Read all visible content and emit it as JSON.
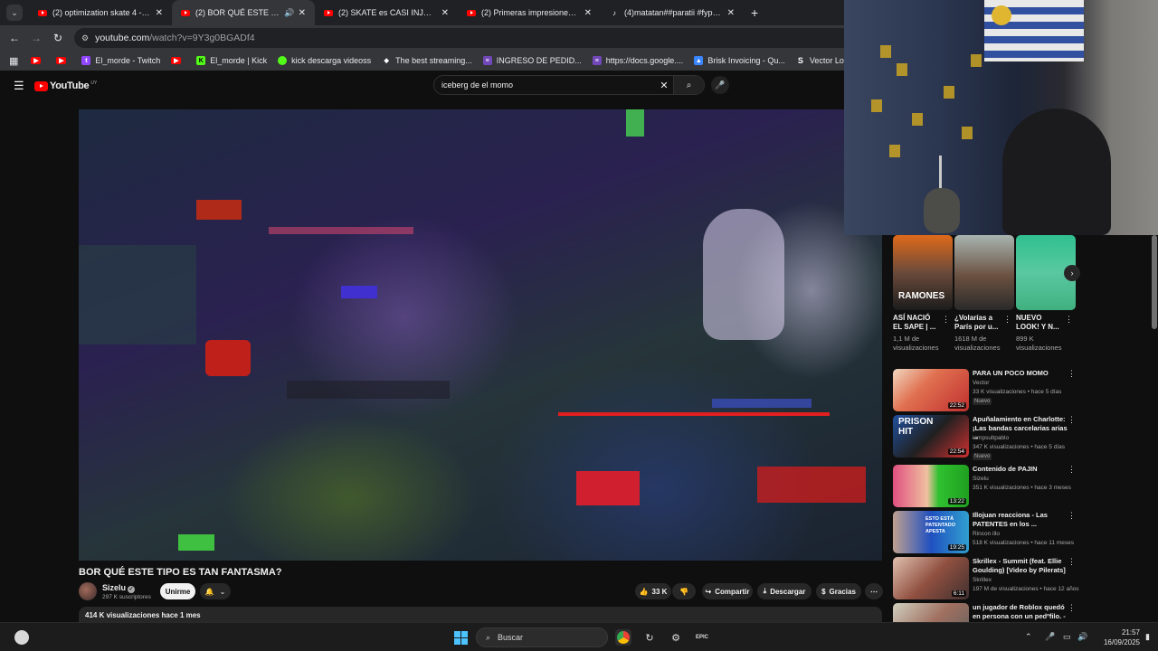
{
  "browser": {
    "tabs": [
      {
        "title": "(2) optimization skate 4 - YouTube",
        "icon": "youtube",
        "active": false
      },
      {
        "title": "(2) BOR QUÉ ESTE TIPO ES TAN FANTASMA?",
        "icon": "youtube",
        "active": true,
        "audio": true
      },
      {
        "title": "(2) SKATE es CASI INJUGABLE en...",
        "icon": "youtube",
        "active": false
      },
      {
        "title": "(2) Primeras impresiones de Mi...",
        "icon": "youtube",
        "active": false
      },
      {
        "title": "(4)matatan##paratii #fyp #ome...",
        "icon": "tiktok",
        "active": false
      }
    ],
    "url_host": "youtube.com",
    "url_path": "/watch?v=9Y3g0BGADf4",
    "bookmarks": [
      {
        "label": "",
        "icon": "youtube",
        "color": "#ff0000"
      },
      {
        "label": "",
        "icon": "youtube",
        "color": "#ff0000"
      },
      {
        "label": "El_morde - Twitch",
        "icon": "twitch",
        "color": "#9146ff"
      },
      {
        "label": "",
        "icon": "youtube",
        "color": "#ff0000"
      },
      {
        "label": "El_morde | Kick",
        "icon": "kick",
        "color": "#53fc18"
      },
      {
        "label": "kick descarga videoss",
        "icon": "kick-alt",
        "color": "#53fc18"
      },
      {
        "label": "The best streaming...",
        "icon": "diamond",
        "color": "#ffffff"
      },
      {
        "label": "INGRESO DE PEDID...",
        "icon": "forms",
        "color": "#7248b9"
      },
      {
        "label": "https://docs.google....",
        "icon": "forms",
        "color": "#7248b9"
      },
      {
        "label": "Brisk Invoicing - Qu...",
        "icon": "brisk",
        "color": "#3a86ff"
      },
      {
        "label": "Vector Logos, PNG L...",
        "icon": "vector",
        "color": "#ffffff"
      },
      {
        "label": "",
        "icon": "x",
        "color": "#000000"
      },
      {
        "label": "",
        "icon": "facebook",
        "color": "#1877f2"
      }
    ]
  },
  "youtube": {
    "logo_text": "YouTube",
    "logo_country": "UY",
    "search_value": "iceberg de el momo",
    "video": {
      "title": "BOR QUÉ ESTE TIPO ES TAN FANTASMA?",
      "channel": "Sizelu",
      "subscribers": "297 K suscriptores",
      "join_label": "Unirme",
      "likes": "33 K",
      "share_label": "Compartir",
      "download_label": "Descargar",
      "thanks_label": "Gracias",
      "views_date": "414 K visualizaciones  hace 1 mes"
    },
    "shorts": [
      {
        "title": "ASÍ NACIÓ EL SAPE | ...",
        "views": "1,1 M de visualizaciones"
      },
      {
        "title": "¿Volarías a París por u...",
        "views": "1618 M de visualizaciones"
      },
      {
        "title": "NUEVO LOOK! Y N...",
        "views": "899 K visualizaciones"
      }
    ],
    "recommended": [
      {
        "title": "PARA UN POCO MOMO",
        "channel": "Vector",
        "meta": "33 K visualizaciones • hace 5 días",
        "badge": "Nuevo",
        "duration": "22:52"
      },
      {
        "title": "Apuñalamiento en Charlotte: ¡Las bandas carcelarias arias ...",
        "channel": "iampsultpablo",
        "meta": "347 K visualizaciones • hace 5 días",
        "badge": "Nuevo",
        "duration": "22:54",
        "thumb_text": "PRISON HIT"
      },
      {
        "title": "Contenido de PAJIN",
        "channel": "Sizelu",
        "meta": "351 K visualizaciones • hace 3 meses",
        "badge": "",
        "duration": "13:22"
      },
      {
        "title": "Illojuan reacciona - Las PATENTES en los ...",
        "channel": "Rincon illo",
        "meta": "518 K visualizaciones • hace 11 meses",
        "badge": "",
        "duration": "19:25",
        "thumb_text": "ESTO ESTÁ PATENTADO APESTA"
      },
      {
        "title": "Skrillex - Summit (feat. Ellie Goulding) [Video by Pilerats]",
        "channel": "Skrillex",
        "meta": "197 M de visualizaciones • hace 12 años",
        "badge": "",
        "duration": "6:11"
      },
      {
        "title": "un jugador de Roblox quedó en persona con un pedºfilo. - ...",
        "channel": "",
        "meta": "",
        "badge": "",
        "duration": ""
      }
    ]
  },
  "taskbar": {
    "search_placeholder": "Buscar",
    "time": "21:57",
    "date": "16/09/2025"
  },
  "webcam": {
    "poster_text": "RAMONES"
  }
}
